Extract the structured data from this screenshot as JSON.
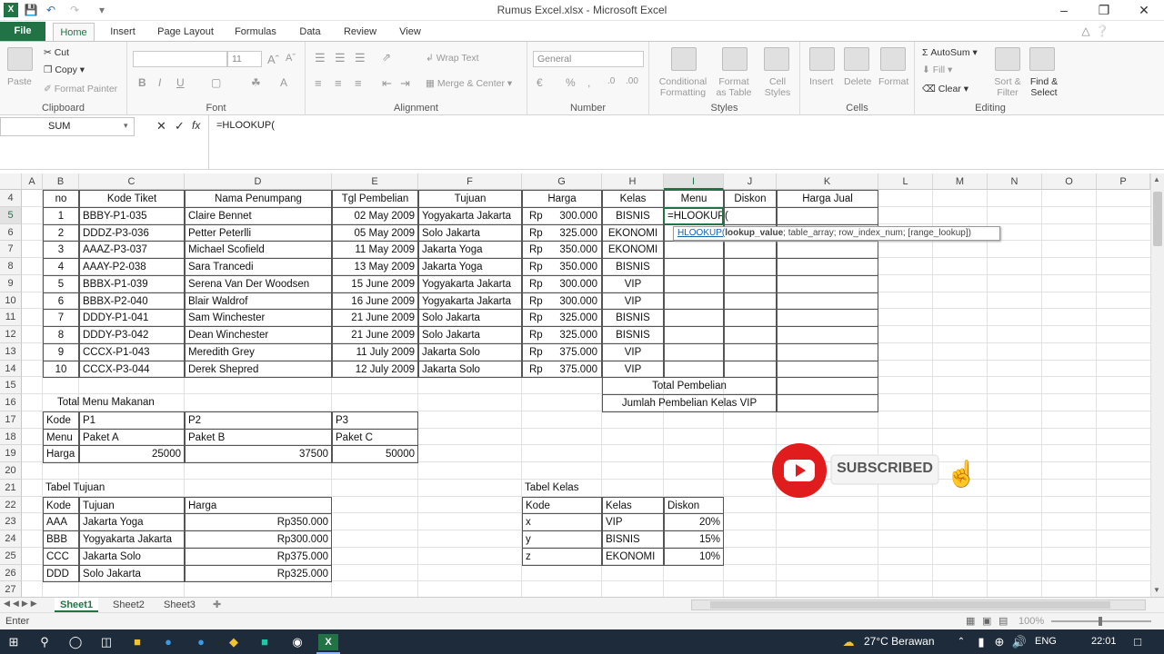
{
  "window": {
    "title": "Rumus Excel.xlsx - Microsoft Excel"
  },
  "tabs": [
    "File",
    "Home",
    "Insert",
    "Page Layout",
    "Formulas",
    "Data",
    "Review",
    "View"
  ],
  "ribbon": {
    "clipboard": {
      "cut": "Cut",
      "copy": "Copy",
      "format_painter": "Format Painter",
      "paste": "Paste",
      "label": "Clipboard"
    },
    "font": {
      "size": "11",
      "label": "Font"
    },
    "alignment": {
      "wrap": "Wrap Text",
      "merge": "Merge & Center",
      "label": "Alignment"
    },
    "number": {
      "format": "General",
      "label": "Number"
    },
    "styles": {
      "conditional": "Conditional Formatting",
      "format_table": "Format as Table",
      "cell_styles": "Cell Styles",
      "label": "Styles"
    },
    "cells": {
      "insert": "Insert",
      "delete": "Delete",
      "format": "Format",
      "label": "Cells"
    },
    "editing": {
      "autosum": "AutoSum",
      "fill": "Fill",
      "clear": "Clear",
      "sort": "Sort & Filter",
      "find": "Find & Select",
      "label": "Editing"
    }
  },
  "formula_bar": {
    "name_box": "SUM",
    "formula": "=HLOOKUP("
  },
  "columns": [
    "A",
    "B",
    "C",
    "D",
    "E",
    "F",
    "G",
    "H",
    "I",
    "J",
    "K",
    "L",
    "M",
    "N",
    "O",
    "P"
  ],
  "rows": [
    "4",
    "5",
    "6",
    "7",
    "8",
    "9",
    "10",
    "11",
    "12",
    "13",
    "14",
    "15",
    "16",
    "17",
    "18",
    "19",
    "20",
    "21",
    "22",
    "23",
    "24",
    "25",
    "26",
    "27"
  ],
  "main_table": {
    "headers": [
      "no",
      "Kode Tiket",
      "Nama Penumpang",
      "Tgl Pembelian",
      "Tujuan",
      "Harga",
      "Kelas",
      "Menu",
      "Diskon",
      "Harga Jual"
    ],
    "rows": [
      [
        "1",
        "BBBY-P1-035",
        "Claire Bennet",
        "02 May 2009",
        "Yogyakarta Jakarta",
        "Rp",
        "300.000",
        "BISNIS"
      ],
      [
        "2",
        "DDDZ-P3-036",
        "Petter Peterlli",
        "05 May 2009",
        "Solo Jakarta",
        "Rp",
        "325.000",
        "EKONOMI"
      ],
      [
        "3",
        "AAAZ-P3-037",
        "Michael Scofield",
        "11 May 2009",
        "Jakarta Yoga",
        "Rp",
        "350.000",
        "EKONOMI"
      ],
      [
        "4",
        "AAAY-P2-038",
        "Sara Trancedi",
        "13 May 2009",
        "Jakarta Yoga",
        "Rp",
        "350.000",
        "BISNIS"
      ],
      [
        "5",
        "BBBX-P1-039",
        "Serena Van Der Woodsen",
        "15 June 2009",
        "Yogyakarta Jakarta",
        "Rp",
        "300.000",
        "VIP"
      ],
      [
        "6",
        "BBBX-P2-040",
        "Blair Waldrof",
        "16 June 2009",
        "Yogyakarta Jakarta",
        "Rp",
        "300.000",
        "VIP"
      ],
      [
        "7",
        "DDDY-P1-041",
        "Sam Winchester",
        "21 June 2009",
        "Solo Jakarta",
        "Rp",
        "325.000",
        "BISNIS"
      ],
      [
        "8",
        "DDDY-P3-042",
        "Dean Winchester",
        "21 June 2009",
        "Solo Jakarta",
        "Rp",
        "325.000",
        "BISNIS"
      ],
      [
        "9",
        "CCCX-P1-043",
        "Meredith Grey",
        "11 July 2009",
        "Jakarta Solo",
        "Rp",
        "375.000",
        "VIP"
      ],
      [
        "10",
        "CCCX-P3-044",
        "Derek Shepred",
        "12 July 2009",
        "Jakarta Solo",
        "Rp",
        "375.000",
        "VIP"
      ]
    ],
    "editing_cell": "=HLOOKUP(",
    "total_pembelian": "Total Pembelian",
    "jumlah_vip": "Jumlah Pembelian Kelas VIP"
  },
  "tooltip": {
    "fn": "HLOOKUP(",
    "arg1": "lookup_value",
    "rest": "; table_array; row_index_num; [range_lookup])"
  },
  "menu_table": {
    "title": "Total Menu Makanan",
    "rows": [
      [
        "Kode",
        "P1",
        "P2",
        "P3"
      ],
      [
        "Menu",
        "Paket A",
        "Paket B",
        "Paket C"
      ],
      [
        "Harga",
        "25000",
        "37500",
        "50000"
      ]
    ]
  },
  "tujuan_table": {
    "title": "Tabel Tujuan",
    "headers": [
      "Kode",
      "Tujuan",
      "Harga"
    ],
    "rows": [
      [
        "AAA",
        "Jakarta Yoga",
        "Rp350.000"
      ],
      [
        "BBB",
        "Yogyakarta Jakarta",
        "Rp300.000"
      ],
      [
        "CCC",
        "Jakarta Solo",
        "Rp375.000"
      ],
      [
        "DDD",
        "Solo Jakarta",
        "Rp325.000"
      ]
    ]
  },
  "kelas_table": {
    "title": "Tabel Kelas",
    "headers": [
      "Kode",
      "Kelas",
      "Diskon"
    ],
    "rows": [
      [
        "x",
        "VIP",
        "20%"
      ],
      [
        "y",
        "BISNIS",
        "15%"
      ],
      [
        "z",
        "EKONOMI",
        "10%"
      ]
    ]
  },
  "overlay": {
    "subscribed": "SUBSCRIBED"
  },
  "sheets": [
    "Sheet1",
    "Sheet2",
    "Sheet3"
  ],
  "status": {
    "mode": "Enter",
    "zoom": "100%"
  },
  "taskbar": {
    "weather": "27°C Berawan",
    "lang": "ENG",
    "time": "22:01"
  }
}
